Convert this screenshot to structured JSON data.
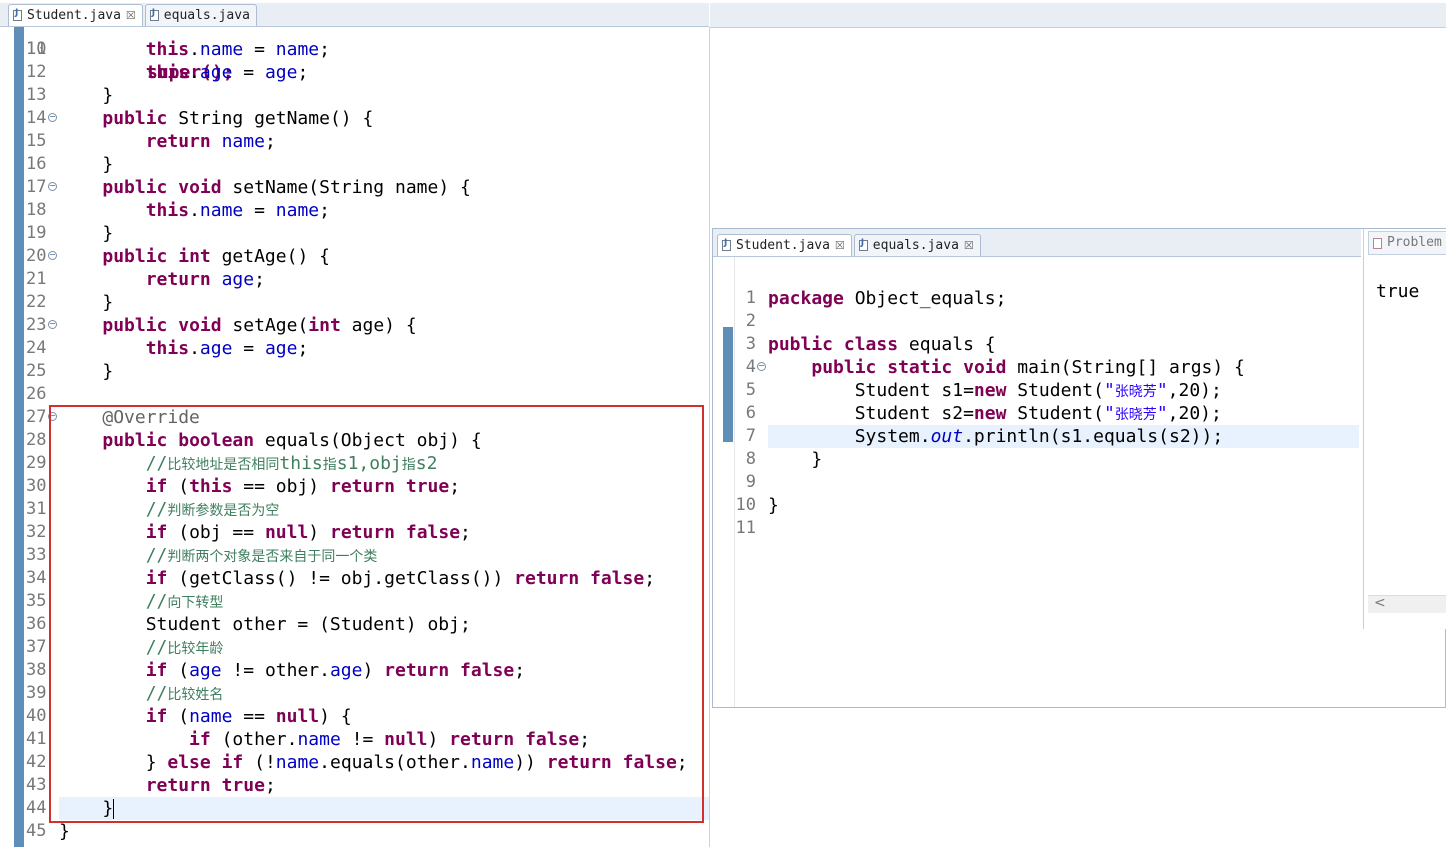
{
  "left_editor": {
    "tabs": [
      {
        "label": "Student.java",
        "close": "☒"
      },
      {
        "label": "equals.java"
      }
    ],
    "first_line_partial": {
      "num": "10",
      "code": "super();"
    },
    "lines": [
      {
        "num": "11",
        "code": "        this.name = name;"
      },
      {
        "num": "12",
        "code": "        this.age = age;"
      },
      {
        "num": "13",
        "code": "    }"
      },
      {
        "num": "14",
        "code": "    public String getName() {"
      },
      {
        "num": "15",
        "code": "        return name;"
      },
      {
        "num": "16",
        "code": "    }"
      },
      {
        "num": "17",
        "code": "    public void setName(String name) {"
      },
      {
        "num": "18",
        "code": "        this.name = name;"
      },
      {
        "num": "19",
        "code": "    }"
      },
      {
        "num": "20",
        "code": "    public int getAge() {"
      },
      {
        "num": "21",
        "code": "        return age;"
      },
      {
        "num": "22",
        "code": "    }"
      },
      {
        "num": "23",
        "code": "    public void setAge(int age) {"
      },
      {
        "num": "24",
        "code": "        this.age = age;"
      },
      {
        "num": "25",
        "code": "    }"
      },
      {
        "num": "26",
        "code": ""
      },
      {
        "num": "27",
        "code": "    @Override"
      },
      {
        "num": "28",
        "code": "    public boolean equals(Object obj) {"
      },
      {
        "num": "29",
        "code": "        //比较地址是否相同this指s1,obj指s2"
      },
      {
        "num": "30",
        "code": "        if (this == obj) return true;"
      },
      {
        "num": "31",
        "code": "        //判断参数是否为空"
      },
      {
        "num": "32",
        "code": "        if (obj == null) return false;"
      },
      {
        "num": "33",
        "code": "        //判断两个对象是否来自于同一个类"
      },
      {
        "num": "34",
        "code": "        if (getClass() != obj.getClass()) return false;"
      },
      {
        "num": "35",
        "code": "        //向下转型"
      },
      {
        "num": "36",
        "code": "        Student other = (Student) obj;"
      },
      {
        "num": "37",
        "code": "        //比较年龄"
      },
      {
        "num": "38",
        "code": "        if (age != other.age) return false;"
      },
      {
        "num": "39",
        "code": "        //比较姓名"
      },
      {
        "num": "40",
        "code": "        if (name == null) {"
      },
      {
        "num": "41",
        "code": "            if (other.name != null) return false;"
      },
      {
        "num": "42",
        "code": "        } else if (!name.equals(other.name)) return false;"
      },
      {
        "num": "43",
        "code": "        return true;"
      },
      {
        "num": "44",
        "code": "    }"
      },
      {
        "num": "45",
        "code": "}"
      }
    ]
  },
  "right_editor": {
    "tabs": [
      {
        "label": "Student.java",
        "close": "☒"
      },
      {
        "label": "equals.java",
        "close": "☒"
      }
    ],
    "lines": [
      {
        "num": "1",
        "code": "package Object_equals;"
      },
      {
        "num": "2",
        "code": ""
      },
      {
        "num": "3",
        "code": "public class equals {"
      },
      {
        "num": "4",
        "code": "    public static void main(String[] args) {"
      },
      {
        "num": "5",
        "code": "        Student s1=new Student(\"张晓芳\",20);"
      },
      {
        "num": "6",
        "code": "        Student s2=new Student(\"张晓芳\",20);"
      },
      {
        "num": "7",
        "code": "        System.out.println(s1.equals(s2));"
      },
      {
        "num": "8",
        "code": "    }"
      },
      {
        "num": "9",
        "code": ""
      },
      {
        "num": "10",
        "code": "}"
      },
      {
        "num": "11",
        "code": ""
      }
    ]
  },
  "console": {
    "tab_label": "Problem",
    "output": "true",
    "scroll_left": "<"
  },
  "colors": {
    "keyword": "#7f0055",
    "field": "#0000c0",
    "string": "#2a00ff",
    "comment": "#3f7f5f",
    "annotation": "#646464",
    "highlight_box": "#d32f2f",
    "current_line": "#e8f2fe"
  }
}
